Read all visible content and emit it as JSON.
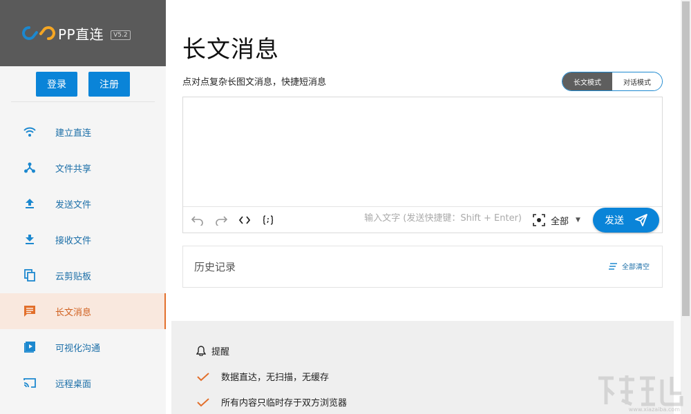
{
  "brand": {
    "name": "PP直连",
    "version": "V5.2",
    "logo": "pp-link-logo",
    "accent": "#1c88cf"
  },
  "auth": {
    "login_label": "登录",
    "register_label": "注册"
  },
  "sidebar": {
    "items": [
      {
        "label": "建立直连",
        "icon": "wifi-icon"
      },
      {
        "label": "文件共享",
        "icon": "share-nodes-icon"
      },
      {
        "label": "发送文件",
        "icon": "upload-icon"
      },
      {
        "label": "接收文件",
        "icon": "download-icon"
      },
      {
        "label": "云剪贴板",
        "icon": "copy-icon"
      },
      {
        "label": "长文消息",
        "icon": "message-icon",
        "active": true
      },
      {
        "label": "可视化沟通",
        "icon": "video-icon"
      },
      {
        "label": "远程桌面",
        "icon": "cast-icon"
      }
    ],
    "active_color": "#e26f2b"
  },
  "main": {
    "title": "长文消息",
    "subtitle": "点对点复杂长图文消息，快捷短消息",
    "modes": {
      "long_label": "长文模式",
      "chat_label": "对话模式",
      "selected": "长文模式"
    },
    "editor": {
      "value": "",
      "hint_placeholder": "输入文字 (发送快捷键：Shift + Enter)",
      "scope_label": "全部",
      "send_label": "发送",
      "tools": [
        "undo-icon",
        "redo-icon",
        "code-icon",
        "code-block-icon"
      ]
    },
    "history": {
      "title": "历史记录",
      "clear_label": "全部清空"
    },
    "notice": {
      "title": "提醒",
      "items": [
        "数据直达，无扫描，无缓存",
        "所有内容只临时存于双方浏览器"
      ]
    }
  },
  "watermark": {
    "text": "www.xiazaiba.com"
  }
}
